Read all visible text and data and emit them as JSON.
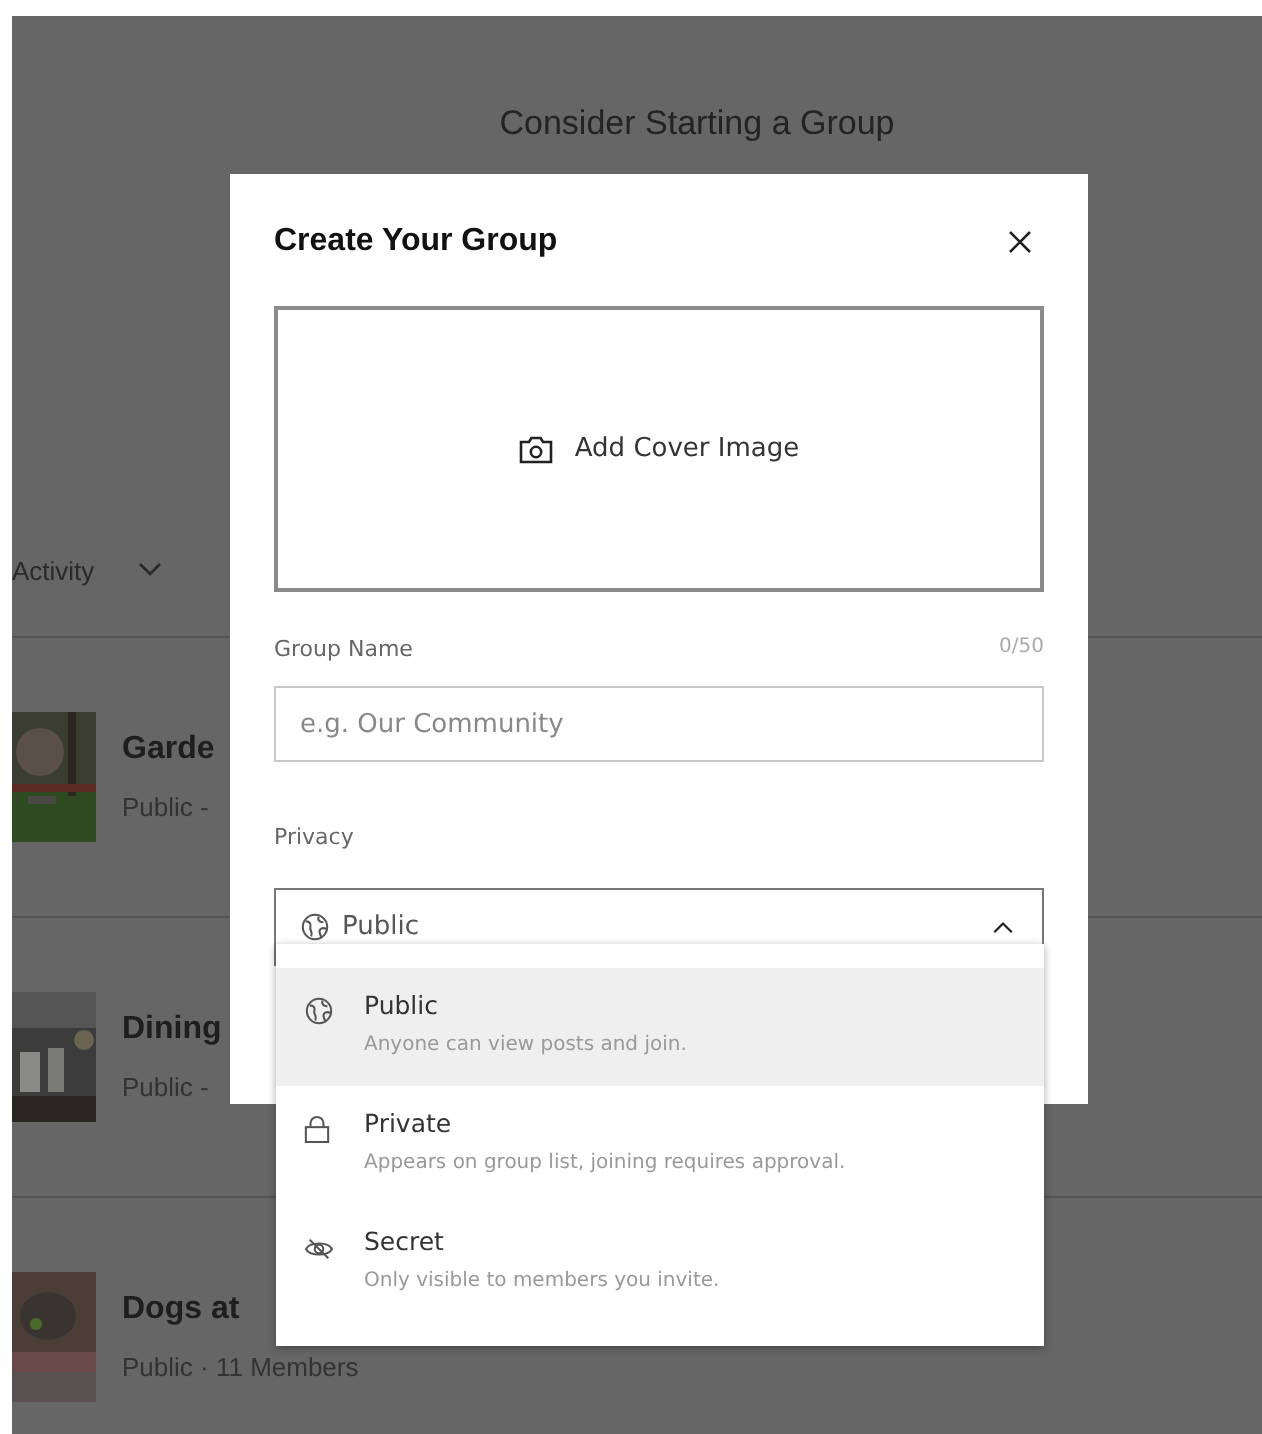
{
  "background": {
    "heading_lines": [
      "Consider Starting a Group"
    ],
    "sort": {
      "label": "Activity"
    },
    "groups": [
      {
        "title": "Garde",
        "subtitle": "Public -"
      },
      {
        "title": "Dining",
        "subtitle": "Public -"
      },
      {
        "title": "Dogs at",
        "subtitle": "Public · 11 Members"
      }
    ]
  },
  "dialog": {
    "title": "Create Your Group",
    "cover": {
      "label": "Add Cover Image"
    },
    "group_name": {
      "label": "Group Name",
      "counter": "0/50",
      "placeholder": "e.g. Our Community"
    },
    "privacy": {
      "label": "Privacy",
      "value": "Public",
      "expanded": true,
      "options": [
        {
          "kind": "public",
          "title": "Public",
          "description": "Anyone can view posts and join.",
          "selected": true
        },
        {
          "kind": "private",
          "title": "Private",
          "description": "Appears on group list, joining requires approval.",
          "selected": false
        },
        {
          "kind": "secret",
          "title": "Secret",
          "description": "Only visible to members you invite.",
          "selected": false
        }
      ]
    }
  }
}
